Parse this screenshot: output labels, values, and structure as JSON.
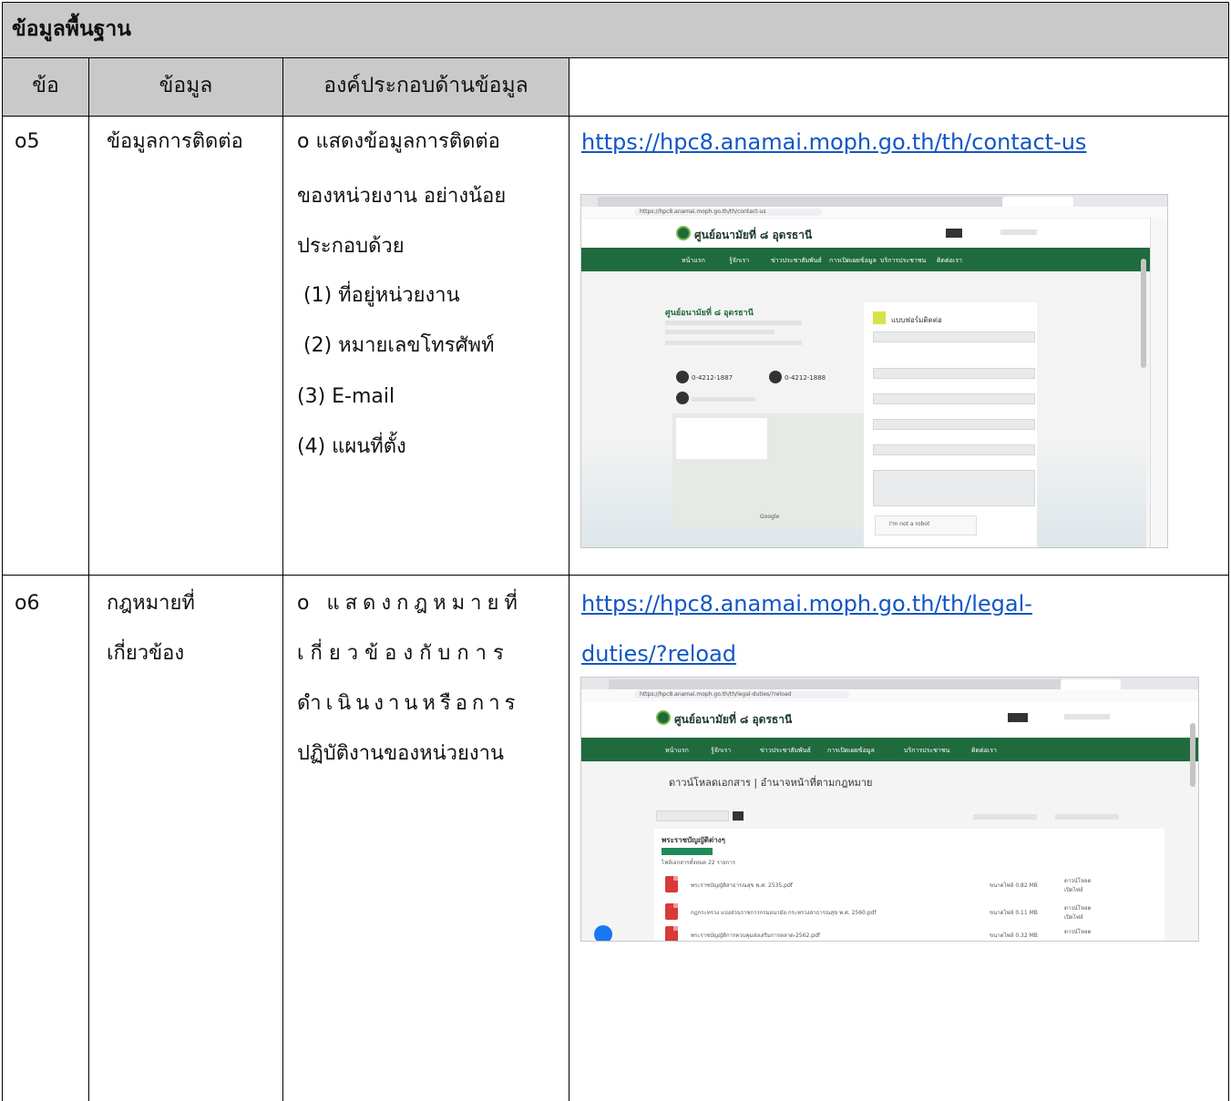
{
  "table": {
    "title": "ข้อมูลพื้นฐาน",
    "headers": [
      "ข้อ",
      "ข้อมูล",
      "องค์ประกอบด้านข้อมูล",
      ""
    ],
    "rows": [
      {
        "id": "o5",
        "name": "ข้อมูลการติดต่อ",
        "details": [
          "o แสดงข้อมูลการติดต่อ",
          "ของหน่วยงาน อย่างน้อย",
          "ประกอบด้วย",
          " (1) ที่อยู่หน่วยงาน",
          " (2) หมายเลขโทรศัพท์",
          "(3) E-mail",
          "(4) แผนที่ตั้ง"
        ],
        "link": "https://hpc8.anamai.moph.go.th/th/contact-us"
      },
      {
        "id": "o6",
        "name_lines": [
          "กฎหมายที่",
          "เกี่ยวข้อง"
        ],
        "details": [
          "o แสดงกฎหมายที่",
          "เกี่ยวข้องกับการ",
          "ดำเนินงานหรือการ",
          "ปฏิบัติงานของหน่วยงาน"
        ],
        "link_lines": [
          "https://hpc8.anamai.moph.go.th/th/legal-",
          "duties/?reload"
        ]
      }
    ]
  },
  "shot1": {
    "url": "https://hpc8.anamai.moph.go.th/th/contact-us",
    "site_title": "ศูนย์อนามัยที่ ๘ อุดรธานี",
    "nav": [
      "หน้าแรก",
      "รู้จักเรา",
      "ข่าวประชาสัมพันธ์",
      "การเปิดเผยข้อมูล",
      "บริการประชาชน",
      "ติดต่อเรา"
    ],
    "org_name": "ศูนย์อนามัยที่ ๘ อุดรธานี",
    "form_title": "แบบฟอร์มติดต่อ",
    "phone1": "0-4212-1887",
    "phone2": "0-4212-1888",
    "recaptcha": "I'm not a robot",
    "map_label": "Google"
  },
  "shot2": {
    "url": "https://hpc8.anamai.moph.go.th/th/legal-duties/?reload",
    "site_title": "ศูนย์อนามัยที่ ๘ อุดรธานี",
    "nav": [
      "หน้าแรก",
      "รู้จักเรา",
      "ข่าวประชาสัมพันธ์",
      "การเปิดเผยข้อมูล",
      "บริการประชาชน",
      "ติดต่อเรา"
    ],
    "page_heading": "ดาวน์โหลดเอกสาร | อำนาจหน้าที่ตามกฎหมาย",
    "section_title": "พระราชบัญญัติต่างๆ",
    "count_text": "ไฟล์เอกสารทั้งหมด 22 รายการ",
    "files": [
      {
        "name": "พระราชบัญญัติสาธารณสุข พ.ศ. 2535.pdf",
        "size": "ขนาดไฟล์ 0.82 MB"
      },
      {
        "name": "กฎกระทรวง แบ่งส่วนราชการกรมอนามัย กระทรวงสาธารณสุข พ.ศ. 2560.pdf",
        "size": "ขนาดไฟล์ 0.11 MB"
      },
      {
        "name": "พระราชบัญญัติการควบคุมส่งเสริมการตลาด-2562.pdf",
        "size": "ขนาดไฟล์ 0.32 MB"
      }
    ],
    "download_label": "ดาวน์โหลด",
    "view_label": "เปิดไฟล์"
  }
}
